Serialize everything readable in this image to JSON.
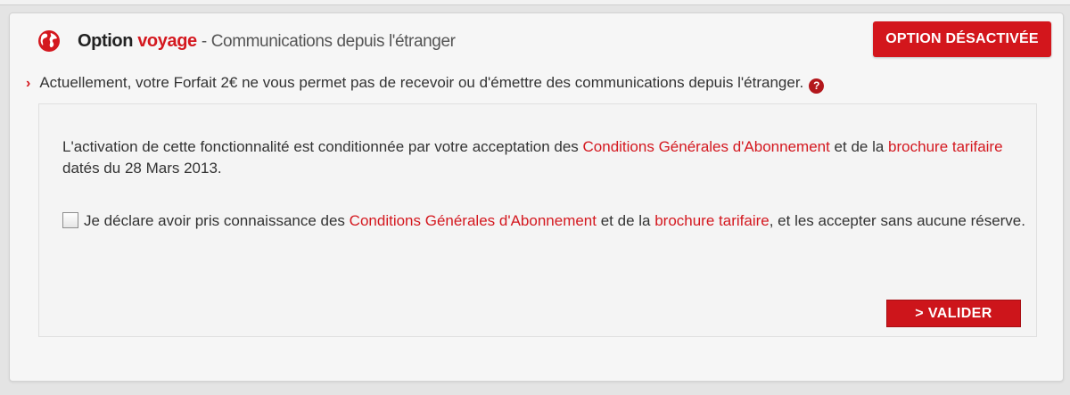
{
  "header": {
    "title_option": "Option",
    "title_voyage": "voyage",
    "title_sub": "- Communications depuis l'étranger",
    "icon": "globe-icon",
    "status_badge": "OPTION DÉSACTIVÉE"
  },
  "info": {
    "chevron": "›",
    "text": "Actuellement, votre Forfait 2€ ne vous permet pas de recevoir ou d'émettre des communications depuis l'étranger.",
    "help_icon": "?"
  },
  "conditions": {
    "intro_1": "L'activation de cette fonctionnalité est conditionnée par votre acceptation des ",
    "link_cga": "Conditions Générales d'Abonnement",
    "intro_2": " et de la ",
    "link_brochure": "brochure tarifaire",
    "intro_3": " datés du 28 Mars 2013."
  },
  "acceptance": {
    "checked": false,
    "text_1": "Je déclare avoir pris connaissance des ",
    "link_cga": "Conditions Générales d'Abonnement",
    "text_2": " et de la ",
    "link_brochure": "brochure tarifaire",
    "text_3": ", et les accepter sans aucune réserve."
  },
  "actions": {
    "validate_label": "> VALIDER"
  },
  "colors": {
    "accent": "#d4181f",
    "background": "#f6f6f6",
    "text": "#333333"
  }
}
